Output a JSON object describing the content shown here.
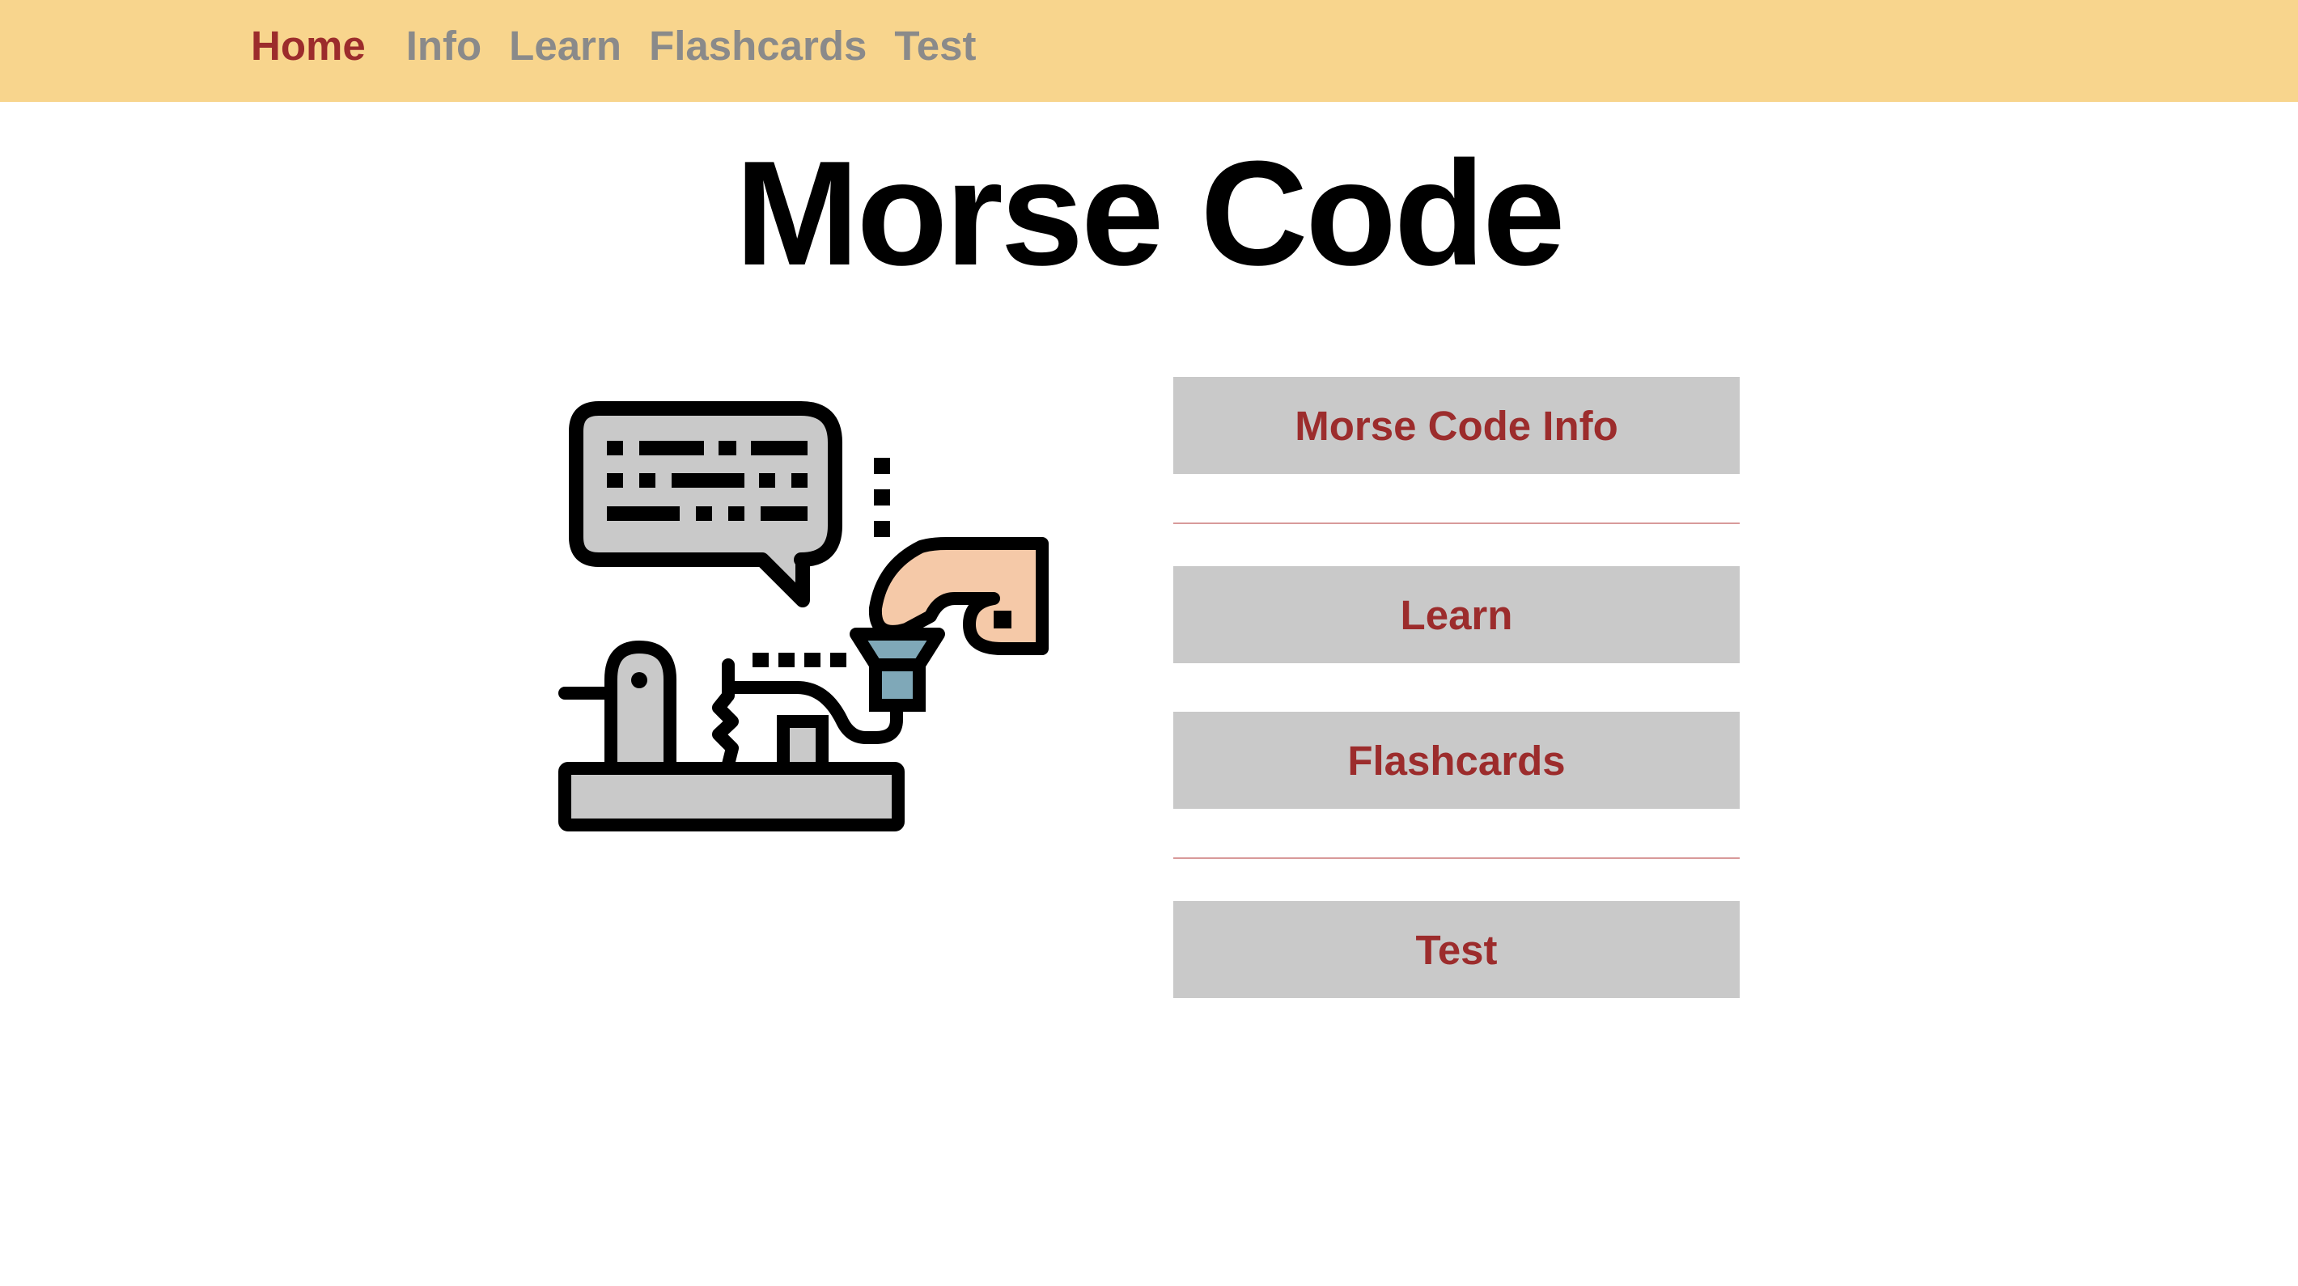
{
  "nav": {
    "items": [
      {
        "label": "Home",
        "active": true
      },
      {
        "label": "Info",
        "active": false
      },
      {
        "label": "Learn",
        "active": false
      },
      {
        "label": "Flashcards",
        "active": false
      },
      {
        "label": "Test",
        "active": false
      }
    ]
  },
  "main": {
    "title": "Morse Code",
    "illustration_icon": "telegraph-key-icon",
    "buttons": [
      {
        "label": "Morse Code Info"
      },
      {
        "label": "Learn"
      },
      {
        "label": "Flashcards"
      },
      {
        "label": "Test"
      }
    ]
  },
  "colors": {
    "navbar_bg": "#f8d58d",
    "nav_active": "#9c2c2c",
    "nav_inactive": "#8a8a8a",
    "button_bg": "#c9c9c9",
    "button_text": "#9c2c2c",
    "divider": "#d89a9a"
  }
}
